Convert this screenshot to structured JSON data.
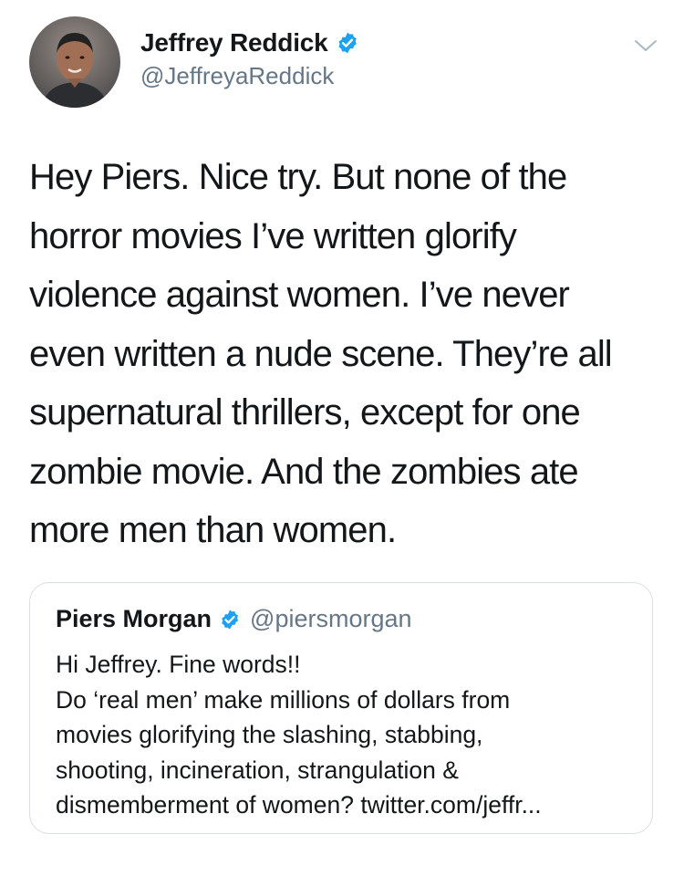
{
  "tweet": {
    "author": {
      "display_name": "Jeffrey Reddick",
      "handle": "@JeffreyaReddick",
      "verified": true,
      "avatar_icon": "profile-photo"
    },
    "menu_icon": "chevron-down-icon",
    "text_lines": [
      "Hey Piers. Nice try. But none of the",
      "horror movies I’ve written glorify",
      "violence against women. I’ve never",
      "even written a nude scene. They’re all",
      "supernatural thrillers, except for one",
      "zombie movie. And the zombies ate",
      "more men than women."
    ]
  },
  "quoted_tweet": {
    "author": {
      "display_name": "Piers Morgan",
      "handle": "@piersmorgan",
      "verified": true
    },
    "text_lines": [
      "Hi Jeffrey. Fine words!!",
      "Do ‘real men’ make millions of dollars from",
      "movies glorifying the slashing, stabbing,",
      "shooting, incineration, strangulation &",
      "dismemberment of women? twitter.com/jeffr..."
    ]
  },
  "colors": {
    "verified_blue": "#1da1f2",
    "secondary_text": "#657786",
    "border": "#d9dee3"
  }
}
